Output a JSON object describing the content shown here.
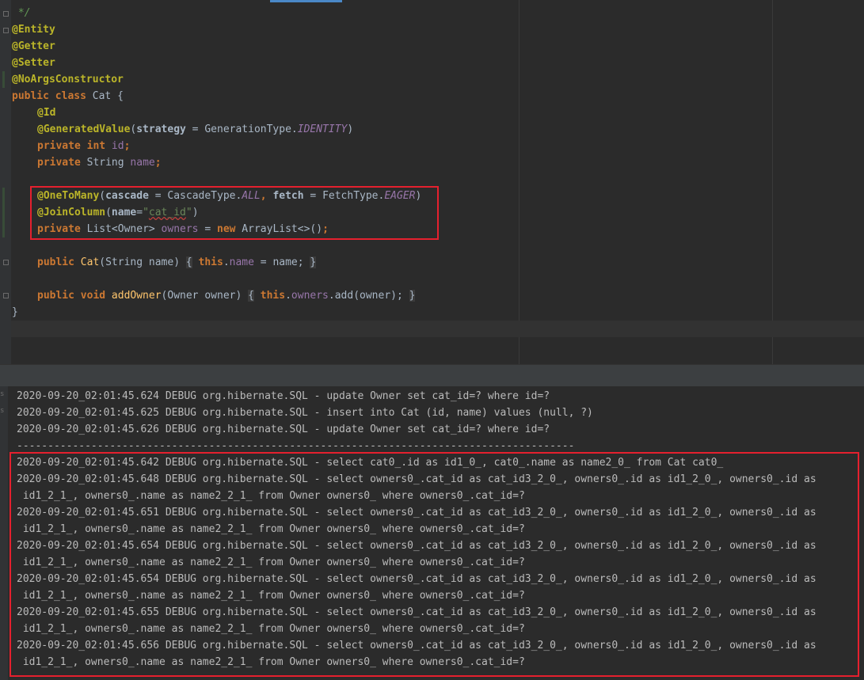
{
  "editor": {
    "line1": {
      "comment": " */"
    },
    "line2": {
      "ann": "@Entity"
    },
    "line3": {
      "ann": "@Getter"
    },
    "line4": {
      "ann": "@Setter"
    },
    "line5": {
      "ann": "@NoArgsConstructor"
    },
    "line6": {
      "kw": "public class",
      "name": " Cat ",
      "brace": "{"
    },
    "line7": {
      "ann": "@Id"
    },
    "line8": {
      "ann": "@GeneratedValue",
      "p1": "(",
      "attr": "strategy",
      "eq": " = GenerationType.",
      "cst": "IDENTITY",
      "p2": ")"
    },
    "line9": {
      "kw": "private int",
      "field": " id",
      "semi": ";"
    },
    "line10": {
      "kw": "private",
      "type": " String ",
      "field": "name",
      "semi": ";"
    },
    "line11": {
      "ann": "@OneToMany",
      "p1": "(",
      "attr1": "cascade",
      "eq1": " = CascadeType.",
      "cst1": "ALL",
      "comma": ", ",
      "attr2": "fetch",
      "eq2": " = FetchType.",
      "cst2": "EAGER",
      "p2": ")"
    },
    "line12": {
      "ann": "@JoinColumn",
      "p1": "(",
      "attr": "name",
      "eq": "=",
      "q1": "\"",
      "str": "cat_id",
      "q2": "\"",
      "p2": ")"
    },
    "line13": {
      "kw": "private",
      "type": " List<Owner> ",
      "field": "owners",
      "eq": " = ",
      "kw2": "new",
      "rest": " ArrayList<>()",
      "semi": ";"
    },
    "line14": {
      "kw": "public",
      "fn": " Cat",
      "params": "(String name) ",
      "ob": "{",
      "sp": " ",
      "kw2": "this",
      "dot": ".",
      "field": "name",
      "rest": " = name; ",
      "cb": "}"
    },
    "line15": {
      "kw": "public void",
      "fn": " addOwner",
      "params": "(Owner owner) ",
      "ob": "{",
      "sp": " ",
      "kw2": "this",
      "dot": ".",
      "field": "owners",
      "rest": ".add(owner); ",
      "cb": "}"
    },
    "line16": {
      "brace": "}"
    }
  },
  "console": {
    "gutter_glyphs": [
      "s",
      "s"
    ],
    "lines": [
      "2020-09-20_02:01:45.624 DEBUG org.hibernate.SQL - update Owner set cat_id=? where id=?",
      "2020-09-20_02:01:45.625 DEBUG org.hibernate.SQL - insert into Cat (id, name) values (null, ?)",
      "2020-09-20_02:01:45.626 DEBUG org.hibernate.SQL - update Owner set cat_id=? where id=?",
      "------------------------------------------------------------------------------------------",
      "2020-09-20_02:01:45.642 DEBUG org.hibernate.SQL - select cat0_.id as id1_0_, cat0_.name as name2_0_ from Cat cat0_",
      "2020-09-20_02:01:45.648 DEBUG org.hibernate.SQL - select owners0_.cat_id as cat_id3_2_0_, owners0_.id as id1_2_0_, owners0_.id as",
      " id1_2_1_, owners0_.name as name2_2_1_ from Owner owners0_ where owners0_.cat_id=?",
      "2020-09-20_02:01:45.651 DEBUG org.hibernate.SQL - select owners0_.cat_id as cat_id3_2_0_, owners0_.id as id1_2_0_, owners0_.id as",
      " id1_2_1_, owners0_.name as name2_2_1_ from Owner owners0_ where owners0_.cat_id=?",
      "2020-09-20_02:01:45.654 DEBUG org.hibernate.SQL - select owners0_.cat_id as cat_id3_2_0_, owners0_.id as id1_2_0_, owners0_.id as",
      " id1_2_1_, owners0_.name as name2_2_1_ from Owner owners0_ where owners0_.cat_id=?",
      "2020-09-20_02:01:45.654 DEBUG org.hibernate.SQL - select owners0_.cat_id as cat_id3_2_0_, owners0_.id as id1_2_0_, owners0_.id as",
      " id1_2_1_, owners0_.name as name2_2_1_ from Owner owners0_ where owners0_.cat_id=?",
      "2020-09-20_02:01:45.655 DEBUG org.hibernate.SQL - select owners0_.cat_id as cat_id3_2_0_, owners0_.id as id1_2_0_, owners0_.id as",
      " id1_2_1_, owners0_.name as name2_2_1_ from Owner owners0_ where owners0_.cat_id=?",
      "2020-09-20_02:01:45.656 DEBUG org.hibernate.SQL - select owners0_.cat_id as cat_id3_2_0_, owners0_.id as id1_2_0_, owners0_.id as",
      " id1_2_1_, owners0_.name as name2_2_1_ from Owner owners0_ where owners0_.cat_id=?"
    ]
  },
  "colors": {
    "highlight_border": "#e5202e",
    "background": "#2b2b2b"
  }
}
